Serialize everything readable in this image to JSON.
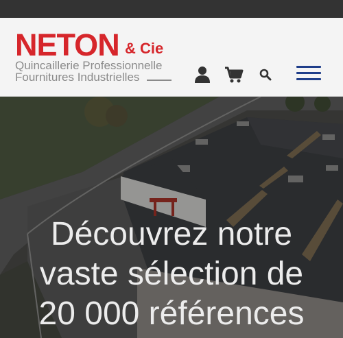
{
  "brand": {
    "name": "NETON",
    "suffix": "& Cie",
    "tagline_1": "Quincaillerie Professionnelle",
    "tagline_2": "Fournitures Industrielles",
    "color": "#d6262b"
  },
  "header": {
    "icons": [
      "user-icon",
      "cart-icon",
      "search-icon",
      "menu-icon"
    ]
  },
  "hero": {
    "line_1": "Découvrez notre",
    "line_2": "vaste sélection de",
    "line_3": "20 000 références"
  },
  "colors": {
    "topbar": "#333333",
    "header_bg": "#f4f4f4",
    "menu_accent": "#1f3e8a",
    "hero_text": "#ececec"
  }
}
